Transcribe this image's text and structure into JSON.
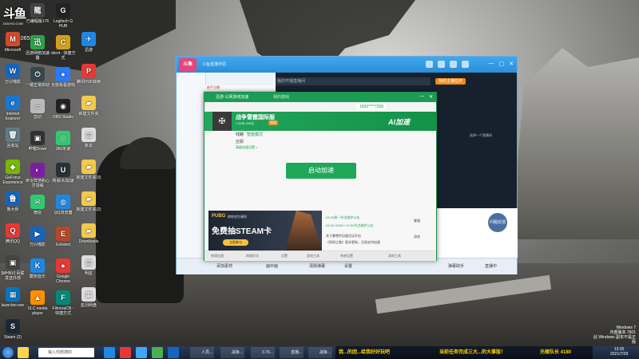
{
  "watermark": {
    "brand": "斗鱼",
    "url": "DOUYU.COM",
    "room_id": "310653"
  },
  "desktop_icons": [
    {
      "label": "Microsoft",
      "glyph": "M",
      "color": "#d24a2c"
    },
    {
      "label": "已编程版176",
      "glyph": "龍",
      "color": "#444"
    },
    {
      "label": "Logitech G HUB",
      "glyph": "G",
      "color": "#222"
    },
    {
      "label": "万兴喵影",
      "glyph": "W",
      "color": "#1565c0"
    },
    {
      "label": "迅游网络加速器",
      "glyph": "迅",
      "color": "#28a745"
    },
    {
      "label": "client - 快捷方式",
      "glyph": "C",
      "color": "#d4a017"
    },
    {
      "label": "迅游",
      "glyph": "✈",
      "color": "#1e88e5"
    },
    {
      "label": "Internet Explorer",
      "glyph": "e",
      "color": "#1976d2"
    },
    {
      "label": "一键正常启动",
      "glyph": "⏻",
      "color": "#37474f"
    },
    {
      "label": "全能看看游戏",
      "glyph": "●",
      "color": "#2979ff"
    },
    {
      "label": "腾讯PDF转换",
      "glyph": "P",
      "color": "#e53935"
    },
    {
      "label": "回收站",
      "glyph": "🗑",
      "color": "#607d8b"
    },
    {
      "label": "剪切",
      "glyph": "▭",
      "color": "#bbb"
    },
    {
      "label": "OBS Studio",
      "glyph": "◉",
      "color": "#222"
    },
    {
      "label": "新建文件夹",
      "glyph": "▰",
      "color": "#f2c94c"
    },
    {
      "label": "GeForce Experience",
      "glyph": "◆",
      "color": "#76b900"
    },
    {
      "label": "哔哩Down",
      "glyph": "▣",
      "color": "#333"
    },
    {
      "label": "360单速",
      "glyph": "◎",
      "color": "#2ecc71"
    },
    {
      "label": "账本",
      "glyph": "▤",
      "color": "#ddd"
    },
    {
      "label": "鲁大师",
      "glyph": "鲁",
      "color": "#1565c0"
    },
    {
      "label": "命令阵地和心灵领域",
      "glyph": "◐",
      "color": "#7b1fa2"
    },
    {
      "label": "网易UU加速",
      "glyph": "U",
      "color": "#263238"
    },
    {
      "label": "新建文件夹(3)",
      "glyph": "▰",
      "color": "#f2c94c"
    },
    {
      "label": "腾讯QQ",
      "glyph": "Q",
      "color": "#e53935"
    },
    {
      "label": "微信",
      "glyph": "✉",
      "color": "#2ecc71"
    },
    {
      "label": "QQ浏览器",
      "glyph": "◍",
      "color": "#1e88e5"
    },
    {
      "label": "新建文件夹(2)",
      "glyph": "▰",
      "color": "#f2c94c"
    },
    {
      "label": "[MHNV] 百联发送外部",
      "glyph": "▣",
      "color": "#444"
    },
    {
      "label": "万兴喵影",
      "glyph": "▶",
      "color": "#1565c0"
    },
    {
      "label": "Enlisted",
      "glyph": "E",
      "color": "#b7472a"
    },
    {
      "label": "Downloads",
      "glyph": "▰",
      "color": "#f2c94c"
    },
    {
      "label": "launcher.exe",
      "glyph": "▦",
      "color": "#0277bd"
    },
    {
      "label": "酷狗音乐",
      "glyph": "K",
      "color": "#1e88e5"
    },
    {
      "label": "Google Chrome",
      "glyph": "●",
      "color": "#e53935"
    },
    {
      "label": "明星",
      "glyph": "▤",
      "color": "#ddd"
    },
    {
      "label": "Steam (2)",
      "glyph": "S",
      "color": "#1b2838"
    },
    {
      "label": "VLC media player",
      "glyph": "▲",
      "color": "#ff8f00"
    },
    {
      "label": "FilmoraCN - 快捷方式",
      "glyph": "F",
      "color": "#00897b"
    },
    {
      "label": "蓝羽网盘",
      "glyph": "▦",
      "color": "#ddd"
    }
  ],
  "main_window": {
    "logo": "斗鱼",
    "title": "斗鱼直播伴侣",
    "search_placeholder": "我的开播直播间",
    "pill": "我的主播任务",
    "sidebar_text": "选择一个直播间",
    "mid_rows": [
      "新手主播",
      "新手主播",
      "新手主播",
      "新手主播",
      "新手主播",
      "新手主播",
      "新手主播",
      "新手主播",
      "新手主播",
      "新手主播",
      "新手主播",
      "新手主播",
      "新手主播",
      "新手主播",
      "新手主播",
      "新手主播",
      "新手主播",
      "新手主播",
      "新手主播",
      "新手主播",
      "新手主播",
      "新手主播",
      "新手主播",
      "新手主播",
      "新手主播"
    ],
    "round_btn": "问题反馈",
    "bottom": [
      "添加素材",
      "画中画",
      "清除弹幕",
      "设置"
    ],
    "bottom_right": [
      "弹幕助手",
      "直播中"
    ]
  },
  "accelerator": {
    "top_title": "迅游 公网游戏加速",
    "top_sub": "我的游戏",
    "vip": "1500****7268",
    "brand": "AI加速",
    "game_name": "战争雷霆国际服",
    "game_size": "1.5GB  239天",
    "game_tag": "国服",
    "mode_label": "线路",
    "mode_value": "智能模式",
    "region": "亚服",
    "link": "高级加速设置 >",
    "start_button": "启动加速",
    "ad": {
      "brand": "PUBG",
      "sub": "绝地求生福利",
      "headline": "免费抽STEAM卡",
      "cta": "立即参与"
    },
    "news": [
      "03-23周一节点维护公告",
      "03-04 05:00～12:00节点维护公告"
    ],
    "news2": [
      "关于暴雪怀旧服活动开启",
      "《剑网之路》版本更新，迅游支持加速"
    ],
    "side": [
      "客服",
      "游戏",
      "活动"
    ],
    "footer": [
      "快速加速",
      "网络优化",
      "设置",
      "游戏工具",
      "系统设置",
      "游戏工具"
    ]
  },
  "taskbar": {
    "search": "输入你想搜的",
    "tasks": [
      "人员...",
      "战争...",
      "3.76...",
      "直播...",
      "战争...",
      "人员..."
    ],
    "marquee": [
      "我...的团...给我好好玩吧",
      "当前任务完成三大...的大事版！",
      "光棱队长 4180"
    ],
    "clock_time": "13:35",
    "clock_date": "2021/7/29",
    "winver": [
      "Windows 7",
      "内部版本 7601",
      "此 Windows 副本不是正版"
    ]
  }
}
